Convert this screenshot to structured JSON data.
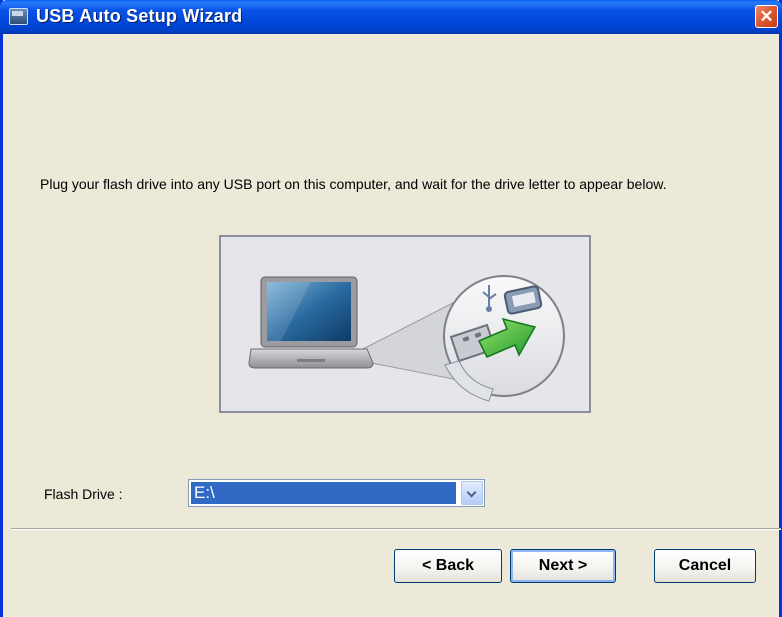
{
  "window": {
    "title": "USB Auto Setup Wizard",
    "close_symbol": "✕"
  },
  "instruction": "Plug your flash drive into any USB port on this computer, and wait for the drive letter to appear below.",
  "flash_drive": {
    "label": "Flash Drive :",
    "selected": "E:\\"
  },
  "buttons": {
    "back": "< Back",
    "next": "Next >",
    "cancel": "Cancel"
  },
  "icons": {
    "app": "usb-wizard-app-icon",
    "close": "close-icon",
    "illustration": "laptop-usb-plug-illustration"
  },
  "colors": {
    "title_bar": "#0054E3",
    "window_bg": "#ECE9D8",
    "selection": "#316AC5",
    "close": "#E05A33",
    "arrow_green": "#3FB73F"
  }
}
